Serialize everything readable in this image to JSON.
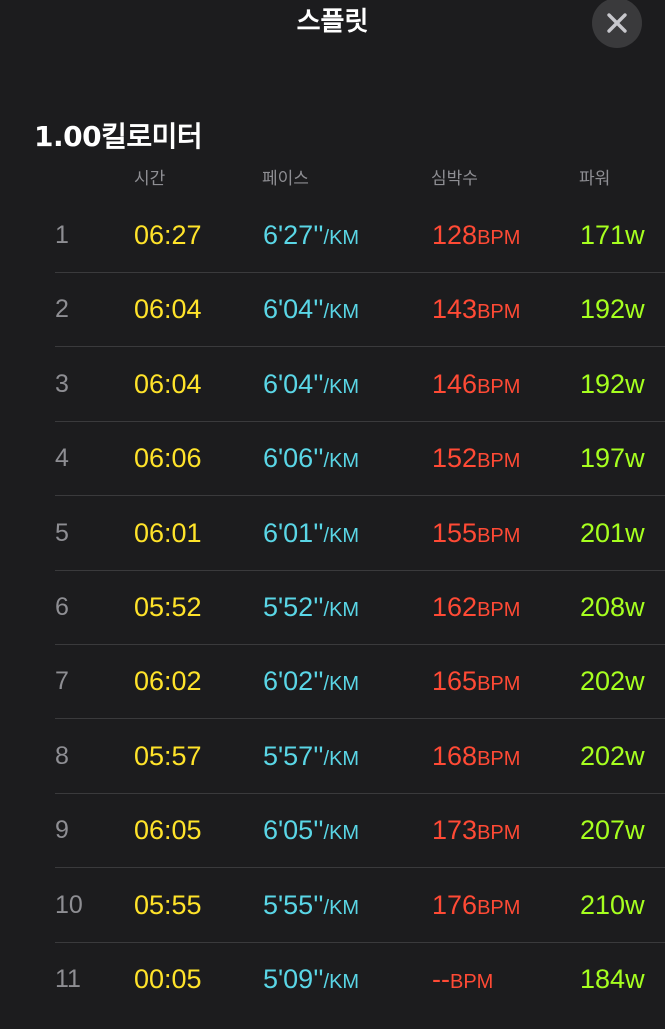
{
  "header": {
    "title": "스플릿",
    "close_icon": "close-icon"
  },
  "section": {
    "title": "1.00킬로미터"
  },
  "columns": {
    "time": "시간",
    "pace": "페이스",
    "heart_rate": "심박수",
    "power": "파워"
  },
  "colors": {
    "background": "#1c1c1e",
    "time": "#ffe32a",
    "pace": "#5ad6e6",
    "heart_rate": "#ff4a35",
    "power": "#a6ff1f",
    "index": "#8e8e93"
  },
  "splits": [
    {
      "index": "1",
      "time": "06:27",
      "pace": "6'27''",
      "pace_unit": "/KM",
      "hr": "128",
      "hr_unit": "BPM",
      "power": "171",
      "power_unit": "w"
    },
    {
      "index": "2",
      "time": "06:04",
      "pace": "6'04''",
      "pace_unit": "/KM",
      "hr": "143",
      "hr_unit": "BPM",
      "power": "192",
      "power_unit": "w"
    },
    {
      "index": "3",
      "time": "06:04",
      "pace": "6'04''",
      "pace_unit": "/KM",
      "hr": "146",
      "hr_unit": "BPM",
      "power": "192",
      "power_unit": "w"
    },
    {
      "index": "4",
      "time": "06:06",
      "pace": "6'06''",
      "pace_unit": "/KM",
      "hr": "152",
      "hr_unit": "BPM",
      "power": "197",
      "power_unit": "w"
    },
    {
      "index": "5",
      "time": "06:01",
      "pace": "6'01''",
      "pace_unit": "/KM",
      "hr": "155",
      "hr_unit": "BPM",
      "power": "201",
      "power_unit": "w"
    },
    {
      "index": "6",
      "time": "05:52",
      "pace": "5'52''",
      "pace_unit": "/KM",
      "hr": "162",
      "hr_unit": "BPM",
      "power": "208",
      "power_unit": "w"
    },
    {
      "index": "7",
      "time": "06:02",
      "pace": "6'02''",
      "pace_unit": "/KM",
      "hr": "165",
      "hr_unit": "BPM",
      "power": "202",
      "power_unit": "w"
    },
    {
      "index": "8",
      "time": "05:57",
      "pace": "5'57''",
      "pace_unit": "/KM",
      "hr": "168",
      "hr_unit": "BPM",
      "power": "202",
      "power_unit": "w"
    },
    {
      "index": "9",
      "time": "06:05",
      "pace": "6'05''",
      "pace_unit": "/KM",
      "hr": "173",
      "hr_unit": "BPM",
      "power": "207",
      "power_unit": "w"
    },
    {
      "index": "10",
      "time": "05:55",
      "pace": "5'55''",
      "pace_unit": "/KM",
      "hr": "176",
      "hr_unit": "BPM",
      "power": "210",
      "power_unit": "w"
    },
    {
      "index": "11",
      "time": "00:05",
      "pace": "5'09''",
      "pace_unit": "/KM",
      "hr": "--",
      "hr_unit": "BPM",
      "power": "184",
      "power_unit": "w"
    }
  ]
}
